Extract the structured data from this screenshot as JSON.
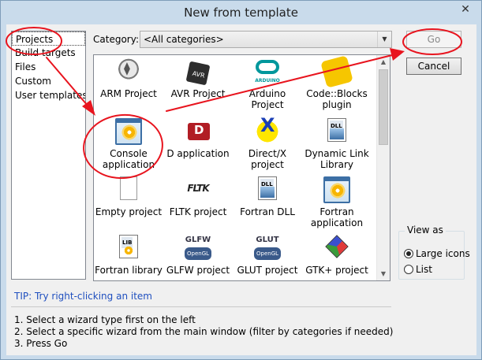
{
  "window": {
    "title": "New from template",
    "close_glyph": "✕"
  },
  "left_list": {
    "items": [
      {
        "label": "Projects",
        "selected": true
      },
      {
        "label": "Build targets"
      },
      {
        "label": "Files"
      },
      {
        "label": "Custom"
      },
      {
        "label": "User templates"
      }
    ]
  },
  "category": {
    "label": "Category:",
    "value": "<All categories>",
    "arrow": "▼"
  },
  "templates": [
    {
      "label": "ARM Project",
      "icon": "gnu-icon"
    },
    {
      "label": "AVR Project",
      "icon": "avr-chip-icon",
      "icon_text": "AVR"
    },
    {
      "label": "Arduino Project",
      "icon": "arduino-icon",
      "icon_text": "ARDUINO"
    },
    {
      "label": "Code::Blocks plugin",
      "icon": "puzzle-icon"
    },
    {
      "label": "Console application",
      "icon": "app-window-icon"
    },
    {
      "label": "D application",
      "icon": "d-language-icon",
      "icon_text": "D"
    },
    {
      "label": "Direct/X project",
      "icon": "directx-icon",
      "icon_text": "X"
    },
    {
      "label": "Dynamic Link Library",
      "icon": "dll-icon",
      "icon_text": "DLL"
    },
    {
      "label": "Empty project",
      "icon": "empty-document-icon"
    },
    {
      "label": "FLTK project",
      "icon": "fltk-icon",
      "icon_text": "FLTK"
    },
    {
      "label": "Fortran DLL",
      "icon": "dll-icon",
      "icon_text": "DLL"
    },
    {
      "label": "Fortran application",
      "icon": "app-window-icon"
    },
    {
      "label": "Fortran library",
      "icon": "lib-icon",
      "icon_text": "LIB"
    },
    {
      "label": "GLFW project",
      "icon": "glfw-icon",
      "icon_text": "GLFW",
      "icon_sub": "OpenGL"
    },
    {
      "label": "GLUT project",
      "icon": "glut-icon",
      "icon_text": "GLUT",
      "icon_sub": "OpenGL"
    },
    {
      "label": "GTK+ project",
      "icon": "gtk-icon"
    }
  ],
  "buttons": {
    "go": "Go",
    "cancel": "Cancel"
  },
  "view_as": {
    "title": "View as",
    "options": [
      {
        "label": "Large icons",
        "checked": true
      },
      {
        "label": "List",
        "checked": false
      }
    ]
  },
  "tip": "TIP: Try right-clicking an item",
  "steps": [
    "1. Select a wizard type first on the left",
    "2. Select a specific wizard from the main window (filter by categories if needed)",
    "3. Press Go"
  ],
  "colors": {
    "annotation_red": "#e8141e",
    "tip_blue": "#1f4fbf"
  }
}
